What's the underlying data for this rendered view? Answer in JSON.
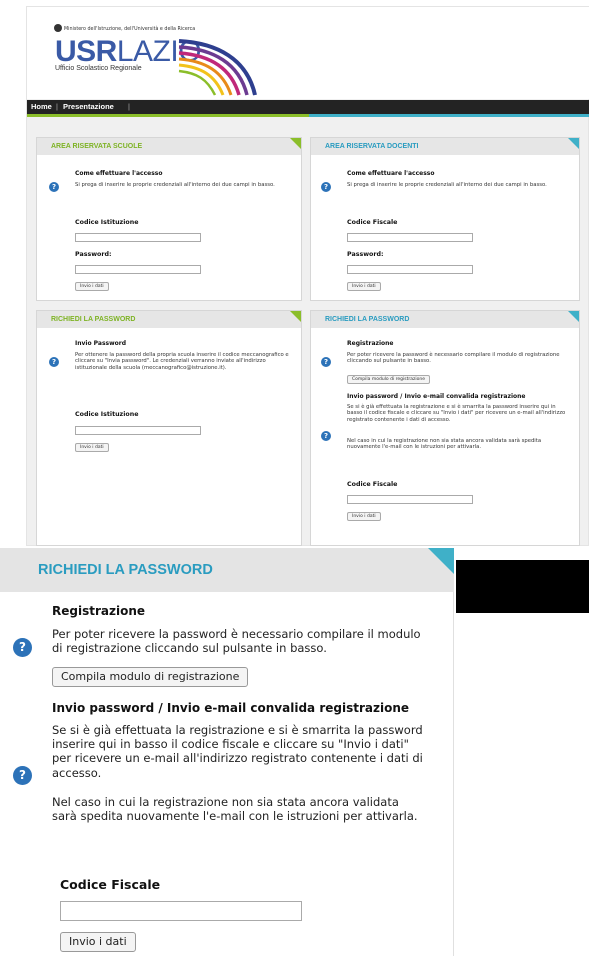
{
  "site": {
    "ministry": "Ministero dell'Istruzione, dell'Università e della Ricerca",
    "logo_bold": "USR",
    "logo_light": "LAZIO",
    "logo_sub": "Ufficio Scolastico Regionale",
    "nav": [
      "Home",
      "Presentazione"
    ],
    "nav_sep": "|"
  },
  "colors": {
    "green": "#8bbe2a",
    "blue": "#3fb0c8",
    "link_blue": "#2a9cc0",
    "navbar": "#232323"
  },
  "panels": {
    "scuole": {
      "title": "AREA RISERVATA SCUOLE",
      "heading": "Come effettuare l'accesso",
      "text": "Si prega di inserire le proprie credenziali all'interno dei due campi in basso.",
      "field1": "Codice Istituzione",
      "field2": "Password:",
      "button": "Invio i dati"
    },
    "docenti": {
      "title": "AREA RISERVATA DOCENTI",
      "heading": "Come effettuare l'accesso",
      "text": "Si prega di inserire le proprie credenziali all'interno dei due campi in basso.",
      "field1": "Codice Fiscale",
      "field2": "Password:",
      "button": "Invio i dati"
    },
    "pwd_scuole": {
      "title": "RICHIEDI LA PASSWORD",
      "heading": "Invio Password",
      "text": "Per ottenere la password della propria scuola inserire il codice meccanografico e cliccare su \"Invia password\". Le credenziali verranno inviate all'indirizzo istituzionale della scuola (meccanografico@istruzione.it).",
      "field": "Codice Istituzione",
      "button": "Invio i dati"
    },
    "pwd_docenti": {
      "title": "RICHIEDI LA PASSWORD",
      "heading1": "Registrazione",
      "text1": "Per poter ricevere la password è necessario compilare il modulo di registrazione cliccando sul pulsante in basso.",
      "button1": "Compila modulo di registrazione",
      "heading2": "Invio password / Invio e-mail convalida registrazione",
      "text2": "Se si è già effettuata la registrazione e si è smarrita la password inserire qui in basso il codice fiscale e cliccare su \"Invio i dati\" per ricevere un e-mail all'indirizzo registrato contenente i dati di accesso.",
      "text3": "Nel caso in cui la registrazione non sia stata ancora validata sarà spedita nuovamente l'e-mail con le istruzioni per attivarla.",
      "field": "Codice Fiscale",
      "button2": "Invio i dati"
    }
  },
  "zoom": {
    "title": "RICHIEDI LA PASSWORD",
    "heading1": "Registrazione",
    "text1": "Per poter ricevere la password è necessario compilare il modulo di registrazione cliccando sul pulsante in basso.",
    "button1": "Compila modulo di registrazione",
    "heading2": "Invio password / Invio e-mail convalida registrazione",
    "text2": "Se si è già effettuata la registrazione e si è smarrita la password inserire qui in basso il codice fiscale e cliccare su \"Invio i dati\" per ricevere un e-mail all'indirizzo registrato contenente i dati di accesso.",
    "text3": "Nel caso in cui la registrazione non sia stata ancora validata sarà spedita nuovamente l'e-mail con le istruzioni per attivarla.",
    "field": "Codice Fiscale",
    "button2": "Invio i dati"
  },
  "icons": {
    "help": "help-icon",
    "emblem": "emblem-icon"
  },
  "help_glyph": "?"
}
